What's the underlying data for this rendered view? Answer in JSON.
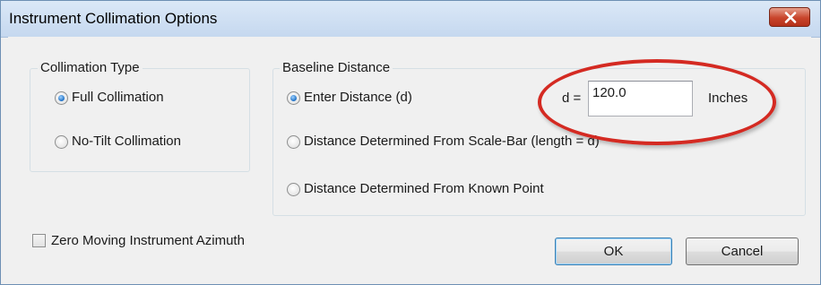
{
  "window": {
    "title": "Instrument Collimation Options",
    "close_icon": "close-icon"
  },
  "collimation_type": {
    "label": "Collimation Type",
    "options": [
      {
        "label": "Full Collimation",
        "checked": true
      },
      {
        "label": "No-Tilt Collimation",
        "checked": false
      }
    ]
  },
  "baseline_distance": {
    "label": "Baseline Distance",
    "options": [
      {
        "label": "Enter Distance (d)",
        "checked": true
      },
      {
        "label": "Distance Determined From Scale-Bar (length = d)",
        "checked": false
      },
      {
        "label": "Distance Determined From Known Point",
        "checked": false
      }
    ],
    "d_label": "d =",
    "d_value": "120.0",
    "units": "Inches"
  },
  "zero_azimuth": {
    "label": "Zero Moving Instrument Azimuth",
    "checked": false
  },
  "buttons": {
    "ok": "OK",
    "cancel": "Cancel"
  },
  "colors": {
    "highlight_ellipse": "#d42a22",
    "title_bar": "#c5d8ef",
    "close_button": "#c8442b"
  }
}
